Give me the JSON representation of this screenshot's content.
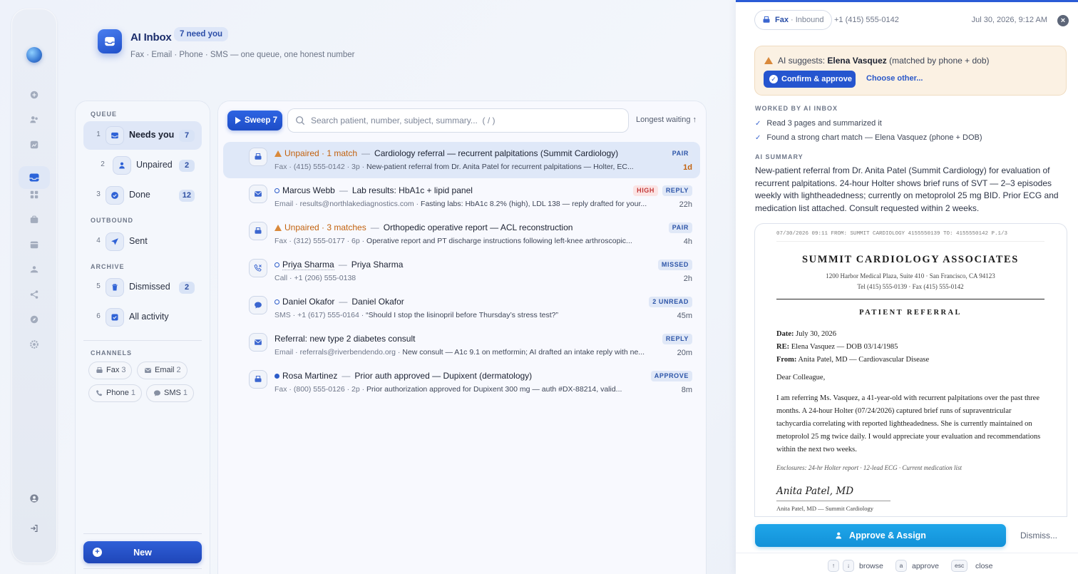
{
  "header": {
    "title": "AI Inbox",
    "badge": "7 need you",
    "subtitle": "Fax · Email · Phone · SMS — one queue, one honest number"
  },
  "queue": {
    "queue_label": "QUEUE",
    "outbound_label": "OUTBOUND",
    "archive_label": "ARCHIVE",
    "channels_label": "CHANNELS",
    "items": [
      {
        "key": "1",
        "label": "Needs you",
        "count": "7",
        "icon": "inbox-icon"
      },
      {
        "key": "2",
        "label": "Unpaired",
        "count": "2",
        "icon": "user-icon"
      },
      {
        "key": "3",
        "label": "Done",
        "count": "12",
        "icon": "check-icon"
      },
      {
        "key": "4",
        "label": "Sent",
        "count": "",
        "icon": "send-icon"
      },
      {
        "key": "5",
        "label": "Dismissed",
        "count": "2",
        "icon": "trash-icon"
      },
      {
        "key": "6",
        "label": "All activity",
        "count": "",
        "icon": "checkbox-icon"
      }
    ],
    "channels": [
      {
        "label": "Fax",
        "count": "3",
        "icon": "fax-icon"
      },
      {
        "label": "Email",
        "count": "2",
        "icon": "mail-icon"
      },
      {
        "label": "Phone",
        "count": "1",
        "icon": "phone-icon"
      },
      {
        "label": "SMS",
        "count": "1",
        "icon": "chat-icon"
      }
    ],
    "new_label": "New"
  },
  "toolbar": {
    "sweep_label": "Sweep 7",
    "search_placeholder": "Search patient, number, subject, summary...  ( / )",
    "sort_label": "Longest waiting ↑"
  },
  "rows": [
    {
      "status": "Unpaired · 1 match",
      "name": "",
      "subject": "Cardiology referral — recurrent palpitations (Summit Cardiology)",
      "channel": "Fax",
      "contact": "(415) 555-0142",
      "extra": "3p",
      "preview": "New-patient referral from Dr. Anita Patel for recurrent palpitations — Holter, EC...",
      "tag": "PAIR",
      "tag2": "",
      "age": "1d"
    },
    {
      "status": "",
      "name": "Marcus Webb",
      "subject": "Lab results: HbA1c + lipid panel",
      "channel": "Email",
      "contact": "results@northlakediagnostics.com",
      "extra": "",
      "preview": "Fasting labs: HbA1c 8.2% (high), LDL 138 — reply drafted for your...",
      "tag": "REPLY",
      "tag2": "HIGH",
      "age": "22h"
    },
    {
      "status": "Unpaired · 3 matches",
      "name": "",
      "subject": "Orthopedic operative report — ACL reconstruction",
      "channel": "Fax",
      "contact": "(312) 555-0177",
      "extra": "6p",
      "preview": "Operative report and PT discharge instructions following left-knee arthroscopic...",
      "tag": "PAIR",
      "tag2": "",
      "age": "4h"
    },
    {
      "status": "",
      "name": "Priya Sharma",
      "subject": "Priya Sharma",
      "channel": "Call",
      "contact": "+1 (206) 555-0138",
      "extra": "",
      "preview": "",
      "tag": "MISSED",
      "tag2": "",
      "age": "2h"
    },
    {
      "status": "",
      "name": "Daniel Okafor",
      "subject": "Daniel Okafor",
      "channel": "SMS",
      "contact": "+1 (617) 555-0164",
      "extra": "",
      "preview": "“Should I stop the lisinopril before Thursday’s stress test?”",
      "tag": "2 UNREAD",
      "tag2": "",
      "age": "45m"
    },
    {
      "status": "",
      "name": "",
      "subject": "Referral: new type 2 diabetes consult",
      "channel": "Email",
      "contact": "referrals@riverbendendo.org",
      "extra": "",
      "preview": "New consult — A1c 9.1 on metformin; AI drafted an intake reply with ne...",
      "tag": "REPLY",
      "tag2": "",
      "age": "20m"
    },
    {
      "status": "",
      "name": "Rosa Martinez",
      "subject": "Prior auth approved — Dupixent (dermatology)",
      "channel": "Fax",
      "contact": "(800) 555-0126",
      "extra": "2p",
      "preview": "Prior authorization approved for Dupixent 300 mg — auth #DX-88214, valid...",
      "tag": "APPROVE",
      "tag2": "",
      "age": "8m"
    }
  ],
  "detail": {
    "channel": "Fax",
    "direction": "· Inbound",
    "phone": "+1 (415) 555-0142",
    "date": "Jul 30, 2026, 9:12 AM",
    "suggest_prefix": "AI suggests: ",
    "suggest_name": "Elena Vasquez",
    "suggest_suffix": " (matched by phone + dob)",
    "confirm_label": "Confirm & approve",
    "choose_label": "Choose other...",
    "worked_label": "WORKED BY AI INBOX",
    "worked": [
      "Read 3 pages and summarized it",
      "Found a strong chart match — Elena Vasquez (phone + DOB)"
    ],
    "summary_label": "AI SUMMARY",
    "summary": "New-patient referral from Dr. Anita Patel (Summit Cardiology) for evaluation of recurrent palpitations. 24-hour Holter shows brief runs of SVT — 2–3 episodes weekly with lightheadedness; currently on metoprolol 25 mg BID. Prior ECG and medication list attached. Consult requested within 2 weeks.",
    "fax": {
      "header_line": "07/30/2026 09:11  FROM: SUMMIT CARDIOLOGY 4155550139  TO: 4155550142  P.1/3",
      "org": "SUMMIT CARDIOLOGY ASSOCIATES",
      "addr1": "1200 Harbor Medical Plaza, Suite 410 · San Francisco, CA 94123",
      "addr2": "Tel (415) 555-0139 · Fax (415) 555-0142",
      "doc_title": "PATIENT REFERRAL",
      "date_label": "Date:",
      "date": " July 30, 2026",
      "re_label": "RE:",
      "re": " Elena Vasquez — DOB 03/14/1985",
      "from_label": "From:",
      "from": " Anita Patel, MD — Cardiovascular Disease",
      "salutation": "Dear Colleague,",
      "body": "I am referring Ms. Vasquez, a 41-year-old with recurrent palpitations over the past three months. A 24-hour Holter (07/24/2026) captured brief runs of supraventricular tachycardia correlating with reported lightheadedness. She is currently maintained on metoprolol 25 mg twice daily. I would appreciate your evaluation and recommendations within the next two weeks.",
      "enclosures": "Enclosures: 24-hr Holter report · 12-lead ECG · Current medication list",
      "signature": "Anita Patel, MD",
      "sig_line": "Anita Patel, MD — Summit Cardiology"
    },
    "approve_label": "Approve & Assign",
    "dismiss_label": "Dismiss...",
    "footer": {
      "browse_up": "↑",
      "browse_down": "↓",
      "browse": "browse",
      "approve_key": "a",
      "approve": "approve",
      "esc_key": "esc",
      "close": "close"
    }
  }
}
